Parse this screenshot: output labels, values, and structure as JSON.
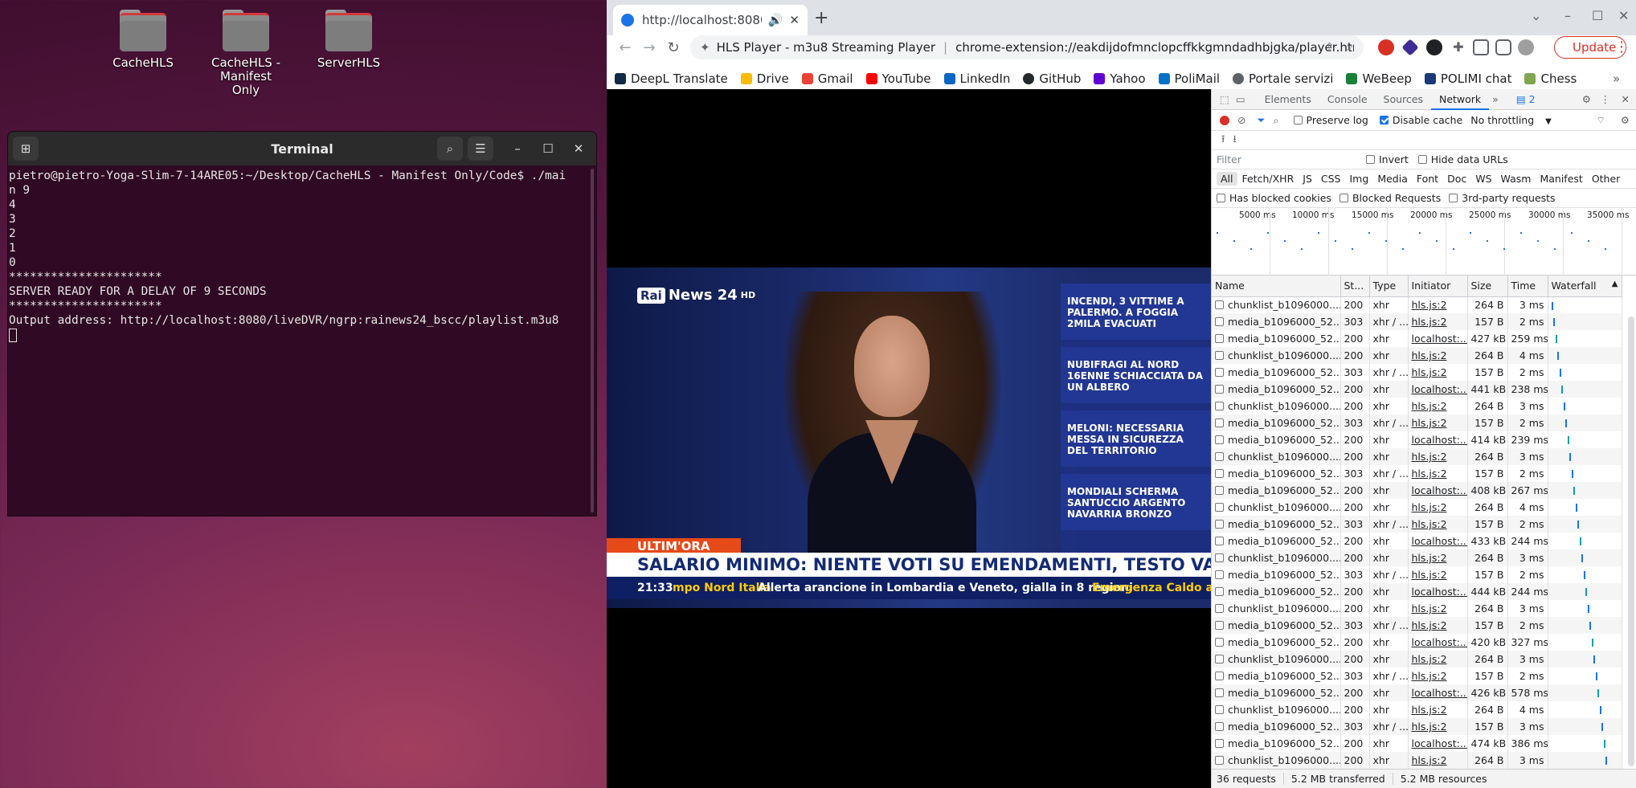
{
  "desktop": {
    "icons": [
      {
        "label": "CacheHLS"
      },
      {
        "label": "CacheHLS - Manifest Only"
      },
      {
        "label": "ServerHLS"
      }
    ]
  },
  "terminal": {
    "title": "Terminal",
    "lines": [
      "pietro@pietro-Yoga-Slim-7-14ARE05:~/Desktop/CacheHLS - Manifest Only/Code$ ./mai",
      "n 9",
      "4",
      "3",
      "2",
      "1",
      "0",
      "**********************",
      "SERVER READY FOR A DELAY OF 9 SECONDS",
      "**********************",
      "Output address: http://localhost:8080/liveDVR/ngrp:rainews24_bscc/playlist.m3u8"
    ]
  },
  "browser": {
    "tab_title": "http://localhost:8080/",
    "site_name": "HLS Player - m3u8 Streaming Player",
    "url": "chrome-extension://eakdijdofmnclopcffkkgmndadhbjgka/player.html#http:/...",
    "update_label": "Update",
    "bookmarks": [
      {
        "label": "DeepL Translate",
        "color": "#0f2b46"
      },
      {
        "label": "Drive",
        "color": "#fbbc04"
      },
      {
        "label": "Gmail",
        "color": "#ea4335"
      },
      {
        "label": "YouTube",
        "color": "#ff0000"
      },
      {
        "label": "LinkedIn",
        "color": "#0a66c2"
      },
      {
        "label": "GitHub",
        "color": "#24292e"
      },
      {
        "label": "Yahoo",
        "color": "#6001d2"
      },
      {
        "label": "PoliMail",
        "color": "#0072c6"
      },
      {
        "label": "Portale servizi",
        "color": "#5f6368"
      },
      {
        "label": "WeBeep",
        "color": "#188038"
      },
      {
        "label": "POLIMI chat",
        "color": "#1a3a7a"
      },
      {
        "label": "Chess",
        "color": "#7fa650"
      }
    ]
  },
  "video": {
    "channel": "News 24",
    "brand": "Rai",
    "hd": "HD",
    "side_news": [
      "INCENDI, 3 VITTIME A PALERMO. A FOGGIA 2MILA EVACUATI",
      "NUBIFRAGI AL NORD 16ENNE SCHIACCIATA DA UN ALBERO",
      "MELONI: NECESSARIA MESSA IN SICUREZZA DEL TERRITORIO",
      "MONDIALI SCHERMA SANTUCCIO ARGENTO NAVARRIA BRONZO"
    ],
    "ultimora": "ULTIM'ORA",
    "headline": "SALARIO MINIMO: NIENTE VOTI SU EMENDAMENTI, TESTO VA IN AULA",
    "time": "21:33",
    "ticker1": "mpo Nord Italia",
    "ticker2": "Allerta arancione in Lombardia e Veneto, gialla in 8 regioni",
    "ticker3": "Emergenza Caldo al S"
  },
  "devtools": {
    "tabs": [
      "Elements",
      "Console",
      "Sources",
      "Network"
    ],
    "issues_count": "2",
    "preserve_log": "Preserve log",
    "disable_cache": "Disable cache",
    "throttling": "No throttling",
    "filter_placeholder": "Filter",
    "invert": "Invert",
    "hide_data_urls": "Hide data URLs",
    "types": [
      "All",
      "Fetch/XHR",
      "JS",
      "CSS",
      "Img",
      "Media",
      "Font",
      "Doc",
      "WS",
      "Wasm",
      "Manifest",
      "Other"
    ],
    "has_blocked_cookies": "Has blocked cookies",
    "blocked_requests": "Blocked Requests",
    "third_party": "3rd-party requests",
    "timeline_labels": [
      "5000 ms",
      "10000 ms",
      "15000 ms",
      "20000 ms",
      "25000 ms",
      "30000 ms",
      "35000 ms"
    ],
    "columns": [
      "Name",
      "St...",
      "Type",
      "Initiator",
      "Size",
      "Time",
      "Waterfall"
    ],
    "rows": [
      {
        "name": "chunklist_b1096000....",
        "status": "200",
        "type": "xhr",
        "initiator": "hls.js:2",
        "size": "264 B",
        "time": "3 ms"
      },
      {
        "name": "media_b1096000_52...",
        "status": "303",
        "type": "xhr / ...",
        "initiator": "hls.js:2",
        "size": "157 B",
        "time": "2 ms"
      },
      {
        "name": "media_b1096000_52...",
        "status": "200",
        "type": "xhr",
        "initiator": "localhost:...",
        "size": "427 kB",
        "time": "259 ms"
      },
      {
        "name": "chunklist_b1096000....",
        "status": "200",
        "type": "xhr",
        "initiator": "hls.js:2",
        "size": "264 B",
        "time": "4 ms"
      },
      {
        "name": "media_b1096000_52...",
        "status": "303",
        "type": "xhr / ...",
        "initiator": "hls.js:2",
        "size": "157 B",
        "time": "2 ms"
      },
      {
        "name": "media_b1096000_52...",
        "status": "200",
        "type": "xhr",
        "initiator": "localhost:...",
        "size": "441 kB",
        "time": "238 ms"
      },
      {
        "name": "chunklist_b1096000....",
        "status": "200",
        "type": "xhr",
        "initiator": "hls.js:2",
        "size": "264 B",
        "time": "3 ms"
      },
      {
        "name": "media_b1096000_52...",
        "status": "303",
        "type": "xhr / ...",
        "initiator": "hls.js:2",
        "size": "157 B",
        "time": "2 ms"
      },
      {
        "name": "media_b1096000_52...",
        "status": "200",
        "type": "xhr",
        "initiator": "localhost:...",
        "size": "414 kB",
        "time": "239 ms"
      },
      {
        "name": "chunklist_b1096000....",
        "status": "200",
        "type": "xhr",
        "initiator": "hls.js:2",
        "size": "264 B",
        "time": "3 ms"
      },
      {
        "name": "media_b1096000_52...",
        "status": "303",
        "type": "xhr / ...",
        "initiator": "hls.js:2",
        "size": "157 B",
        "time": "2 ms"
      },
      {
        "name": "media_b1096000_52...",
        "status": "200",
        "type": "xhr",
        "initiator": "localhost:...",
        "size": "408 kB",
        "time": "267 ms"
      },
      {
        "name": "chunklist_b1096000....",
        "status": "200",
        "type": "xhr",
        "initiator": "hls.js:2",
        "size": "264 B",
        "time": "4 ms"
      },
      {
        "name": "media_b1096000_52...",
        "status": "303",
        "type": "xhr / ...",
        "initiator": "hls.js:2",
        "size": "157 B",
        "time": "2 ms"
      },
      {
        "name": "media_b1096000_52...",
        "status": "200",
        "type": "xhr",
        "initiator": "localhost:...",
        "size": "433 kB",
        "time": "244 ms"
      },
      {
        "name": "chunklist_b1096000....",
        "status": "200",
        "type": "xhr",
        "initiator": "hls.js:2",
        "size": "264 B",
        "time": "3 ms"
      },
      {
        "name": "media_b1096000_52...",
        "status": "303",
        "type": "xhr / ...",
        "initiator": "hls.js:2",
        "size": "157 B",
        "time": "2 ms"
      },
      {
        "name": "media_b1096000_52...",
        "status": "200",
        "type": "xhr",
        "initiator": "localhost:...",
        "size": "444 kB",
        "time": "244 ms"
      },
      {
        "name": "chunklist_b1096000....",
        "status": "200",
        "type": "xhr",
        "initiator": "hls.js:2",
        "size": "264 B",
        "time": "3 ms"
      },
      {
        "name": "media_b1096000_52...",
        "status": "303",
        "type": "xhr / ...",
        "initiator": "hls.js:2",
        "size": "157 B",
        "time": "2 ms"
      },
      {
        "name": "media_b1096000_52...",
        "status": "200",
        "type": "xhr",
        "initiator": "localhost:...",
        "size": "420 kB",
        "time": "327 ms"
      },
      {
        "name": "chunklist_b1096000....",
        "status": "200",
        "type": "xhr",
        "initiator": "hls.js:2",
        "size": "264 B",
        "time": "3 ms"
      },
      {
        "name": "media_b1096000_52...",
        "status": "303",
        "type": "xhr / ...",
        "initiator": "hls.js:2",
        "size": "157 B",
        "time": "2 ms"
      },
      {
        "name": "media_b1096000_52...",
        "status": "200",
        "type": "xhr",
        "initiator": "localhost:...",
        "size": "426 kB",
        "time": "578 ms"
      },
      {
        "name": "chunklist_b1096000....",
        "status": "200",
        "type": "xhr",
        "initiator": "hls.js:2",
        "size": "264 B",
        "time": "4 ms"
      },
      {
        "name": "media_b1096000_52...",
        "status": "303",
        "type": "xhr / ...",
        "initiator": "hls.js:2",
        "size": "157 B",
        "time": "3 ms"
      },
      {
        "name": "media_b1096000_52...",
        "status": "200",
        "type": "xhr",
        "initiator": "localhost:...",
        "size": "474 kB",
        "time": "386 ms"
      },
      {
        "name": "chunklist_b1096000....",
        "status": "200",
        "type": "xhr",
        "initiator": "hls.js:2",
        "size": "264 B",
        "time": "3 ms"
      }
    ],
    "summary": {
      "requests": "36 requests",
      "transferred": "5.2 MB transferred",
      "resources": "5.2 MB resources"
    }
  }
}
